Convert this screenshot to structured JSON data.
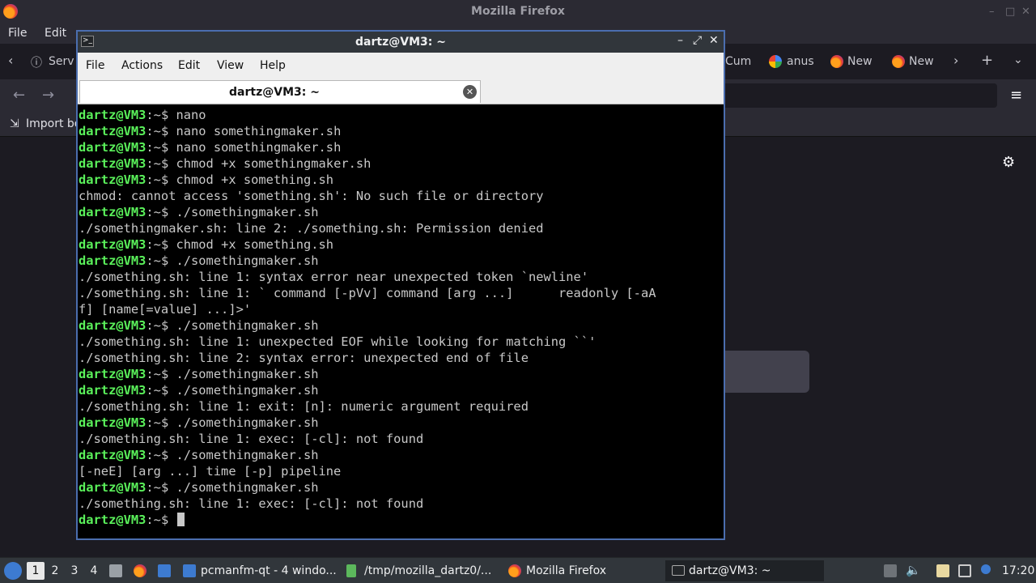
{
  "firefox": {
    "window_title": "Mozilla Firefox",
    "menu": {
      "file": "File",
      "edit": "Edit"
    },
    "tabs": {
      "serv": "Serv",
      "cum": "Cum",
      "anus": "anus",
      "new1": "New",
      "new2": "New"
    },
    "bookmarks": {
      "import": "Import bo"
    }
  },
  "terminal": {
    "window_title": "dartz@VM3: ~",
    "menu": {
      "file": "File",
      "actions": "Actions",
      "edit": "Edit",
      "view": "View",
      "help": "Help"
    },
    "tab_label": "dartz@VM3: ~",
    "prompt_text": "dartz@VM3",
    "lines": [
      {
        "cwd": ":~$ ",
        "cmd": "nano"
      },
      {
        "cwd": ":~$ ",
        "cmd": "nano somethingmaker.sh"
      },
      {
        "cwd": ":~$ ",
        "cmd": "nano somethingmaker.sh"
      },
      {
        "cwd": ":~$ ",
        "cmd": "chmod +x somethingmaker.sh"
      },
      {
        "cwd": ":~$ ",
        "cmd": "chmod +x something.sh"
      },
      {
        "out": "chmod: cannot access 'something.sh': No such file or directory"
      },
      {
        "cwd": ":~$ ",
        "cmd": "./somethingmaker.sh"
      },
      {
        "out": "./somethingmaker.sh: line 2: ./something.sh: Permission denied"
      },
      {
        "cwd": ":~$ ",
        "cmd": "chmod +x something.sh"
      },
      {
        "cwd": ":~$ ",
        "cmd": "./somethingmaker.sh"
      },
      {
        "out": "./something.sh: line 1: syntax error near unexpected token `newline'"
      },
      {
        "out": "./something.sh: line 1: ` command [-pVv] command [arg ...]      readonly [-aA"
      },
      {
        "out": "f] [name[=value] ...]>'"
      },
      {
        "cwd": ":~$ ",
        "cmd": "./somethingmaker.sh"
      },
      {
        "out": "./something.sh: line 1: unexpected EOF while looking for matching ``'"
      },
      {
        "out": "./something.sh: line 2: syntax error: unexpected end of file"
      },
      {
        "cwd": ":~$ ",
        "cmd": "./somethingmaker.sh"
      },
      {
        "cwd": ":~$ ",
        "cmd": "./somethingmaker.sh"
      },
      {
        "out": "./something.sh: line 1: exit: [n]: numeric argument required"
      },
      {
        "cwd": ":~$ ",
        "cmd": "./somethingmaker.sh"
      },
      {
        "out": "./something.sh: line 1: exec: [-cl]: not found"
      },
      {
        "cwd": ":~$ ",
        "cmd": "./somethingmaker.sh"
      },
      {
        "out": "[-neE] [arg ...] time [-p] pipeline"
      },
      {
        "cwd": ":~$ ",
        "cmd": "./somethingmaker.sh"
      },
      {
        "out": "./something.sh: line 1: exec: [-cl]: not found"
      },
      {
        "cwd": ":~$ ",
        "cmd": "",
        "cursor": true
      }
    ]
  },
  "taskbar": {
    "desktops": [
      "1",
      "2",
      "3",
      "4"
    ],
    "tasks": {
      "pcmanfm": "pcmanfm-qt - 4 windo...",
      "tmp": "/tmp/mozilla_dartz0/...",
      "firefox": "Mozilla Firefox",
      "terminal": "dartz@VM3: ~"
    },
    "clock": "17:20"
  }
}
